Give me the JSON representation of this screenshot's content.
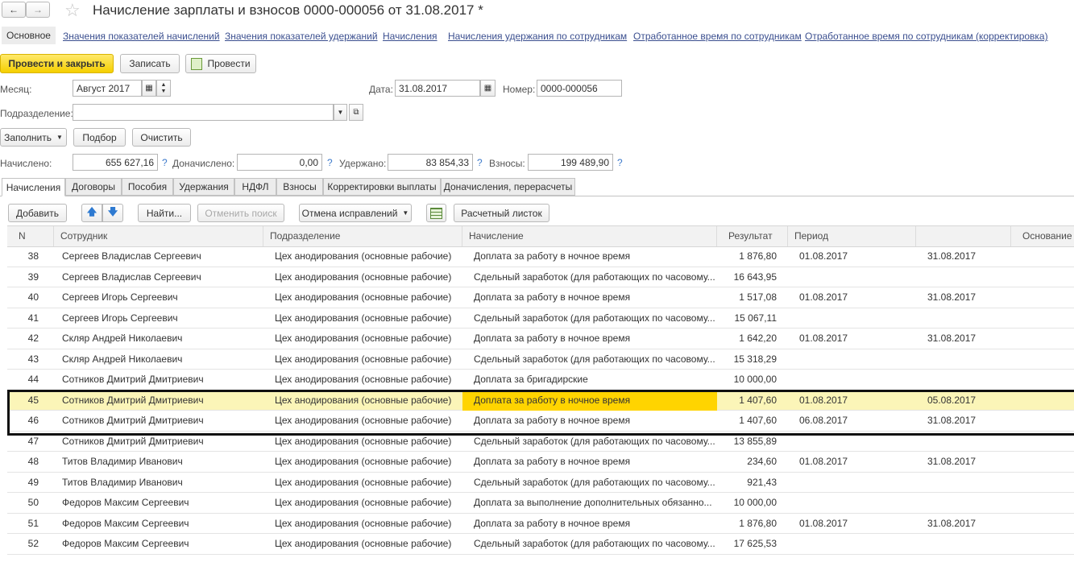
{
  "window": {
    "title": "Начисление зарплаты и взносов 0000-000056 от 31.08.2017 *"
  },
  "nav_links": [
    "Основное",
    "Значения показателей начислений",
    "Значения показателей удержаний",
    "Начисления",
    "Начисления удержания по сотрудникам",
    "Отработанное время по сотрудникам",
    "Отработанное время по сотрудникам (корректировка)"
  ],
  "toolbar": {
    "post_close": "Провести и закрыть",
    "save": "Записать",
    "post": "Провести"
  },
  "form": {
    "month_label": "Месяц:",
    "month_value": "Август 2017",
    "date_label": "Дата:",
    "date_value": "31.08.2017",
    "number_label": "Номер:",
    "number_value": "0000-000056",
    "dept_label": "Подразделение:",
    "dept_value": "",
    "fill_btn": "Заполнить",
    "pick_btn": "Подбор",
    "clear_btn": "Очистить",
    "accrued_label": "Начислено:",
    "accrued_value": "655 627,16",
    "extra_label": "Доначислено:",
    "extra_value": "0,00",
    "withheld_label": "Удержано:",
    "withheld_value": "83 854,33",
    "contrib_label": "Взносы:",
    "contrib_value": "199 489,90",
    "q": "?"
  },
  "tabs": [
    "Начисления",
    "Договоры",
    "Пособия",
    "Удержания",
    "НДФЛ",
    "Взносы",
    "Корректировки выплаты",
    "Доначисления, перерасчеты"
  ],
  "grid_toolbar": {
    "add": "Добавить",
    "find": "Найти...",
    "cancel_search": "Отменить поиск",
    "cancel_corrections": "Отмена исправлений",
    "payslip": "Расчетный листок"
  },
  "columns": [
    "N",
    "Сотрудник",
    "Подразделение",
    "Начисление",
    "Результат",
    "Период",
    "",
    "Основание"
  ],
  "rows": [
    {
      "n": "38",
      "emp": "Сергеев Владислав Сергеевич",
      "dept": "Цех анодирования (основные рабочие)",
      "acc": "Доплата за работу в ночное время",
      "res": "1 876,80",
      "from": "01.08.2017",
      "to": "31.08.2017"
    },
    {
      "n": "39",
      "emp": "Сергеев Владислав Сергеевич",
      "dept": "Цех анодирования (основные рабочие)",
      "acc": "Сдельный заработок (для работающих по часовому...",
      "res": "16 643,95",
      "from": "",
      "to": ""
    },
    {
      "n": "40",
      "emp": "Сергеев Игорь Сергеевич",
      "dept": "Цех анодирования (основные рабочие)",
      "acc": "Доплата за работу в ночное время",
      "res": "1 517,08",
      "from": "01.08.2017",
      "to": "31.08.2017"
    },
    {
      "n": "41",
      "emp": "Сергеев Игорь Сергеевич",
      "dept": "Цех анодирования (основные рабочие)",
      "acc": "Сдельный заработок (для работающих по часовому...",
      "res": "15 067,11",
      "from": "",
      "to": ""
    },
    {
      "n": "42",
      "emp": "Скляр Андрей Николаевич",
      "dept": "Цех анодирования (основные рабочие)",
      "acc": "Доплата за работу в ночное время",
      "res": "1 642,20",
      "from": "01.08.2017",
      "to": "31.08.2017"
    },
    {
      "n": "43",
      "emp": "Скляр Андрей Николаевич",
      "dept": "Цех анодирования (основные рабочие)",
      "acc": "Сдельный заработок (для работающих по часовому...",
      "res": "15 318,29",
      "from": "",
      "to": ""
    },
    {
      "n": "44",
      "emp": "Сотников Дмитрий Дмитриевич",
      "dept": "Цех анодирования (основные рабочие)",
      "acc": "Доплата за бригадирские",
      "res": "10 000,00",
      "from": "",
      "to": ""
    },
    {
      "n": "45",
      "emp": "Сотников Дмитрий Дмитриевич",
      "dept": "Цех анодирования (основные рабочие)",
      "acc": "Доплата за работу в ночное время",
      "res": "1 407,60",
      "from": "01.08.2017",
      "to": "05.08.2017"
    },
    {
      "n": "46",
      "emp": "Сотников Дмитрий Дмитриевич",
      "dept": "Цех анодирования (основные рабочие)",
      "acc": "Доплата за работу в ночное время",
      "res": "1 407,60",
      "from": "06.08.2017",
      "to": "31.08.2017"
    },
    {
      "n": "47",
      "emp": "Сотников Дмитрий Дмитриевич",
      "dept": "Цех анодирования (основные рабочие)",
      "acc": "Сдельный заработок (для работающих по часовому...",
      "res": "13 855,89",
      "from": "",
      "to": ""
    },
    {
      "n": "48",
      "emp": "Титов Владимир Иванович",
      "dept": "Цех анодирования (основные рабочие)",
      "acc": "Доплата за работу в ночное время",
      "res": "234,60",
      "from": "01.08.2017",
      "to": "31.08.2017"
    },
    {
      "n": "49",
      "emp": "Титов Владимир Иванович",
      "dept": "Цех анодирования (основные рабочие)",
      "acc": "Сдельный заработок (для работающих по часовому...",
      "res": "921,43",
      "from": "",
      "to": ""
    },
    {
      "n": "50",
      "emp": "Федоров Максим Сергеевич",
      "dept": "Цех анодирования (основные рабочие)",
      "acc": "Доплата за выполнение дополнительных обязанно...",
      "res": "10 000,00",
      "from": "",
      "to": ""
    },
    {
      "n": "51",
      "emp": "Федоров Максим Сергеевич",
      "dept": "Цех анодирования (основные рабочие)",
      "acc": "Доплата за работу в ночное время",
      "res": "1 876,80",
      "from": "01.08.2017",
      "to": "31.08.2017"
    },
    {
      "n": "52",
      "emp": "Федоров Максим Сергеевич",
      "dept": "Цех анодирования (основные рабочие)",
      "acc": "Сдельный заработок (для работающих по часовому...",
      "res": "17 625,53",
      "from": "",
      "to": ""
    }
  ],
  "selected_row": 7,
  "colors": {
    "accent": "#f5cf00",
    "selected_row": "#fbf5b8",
    "selected_cell": "#ffd400",
    "link": "#3b4f8f"
  }
}
